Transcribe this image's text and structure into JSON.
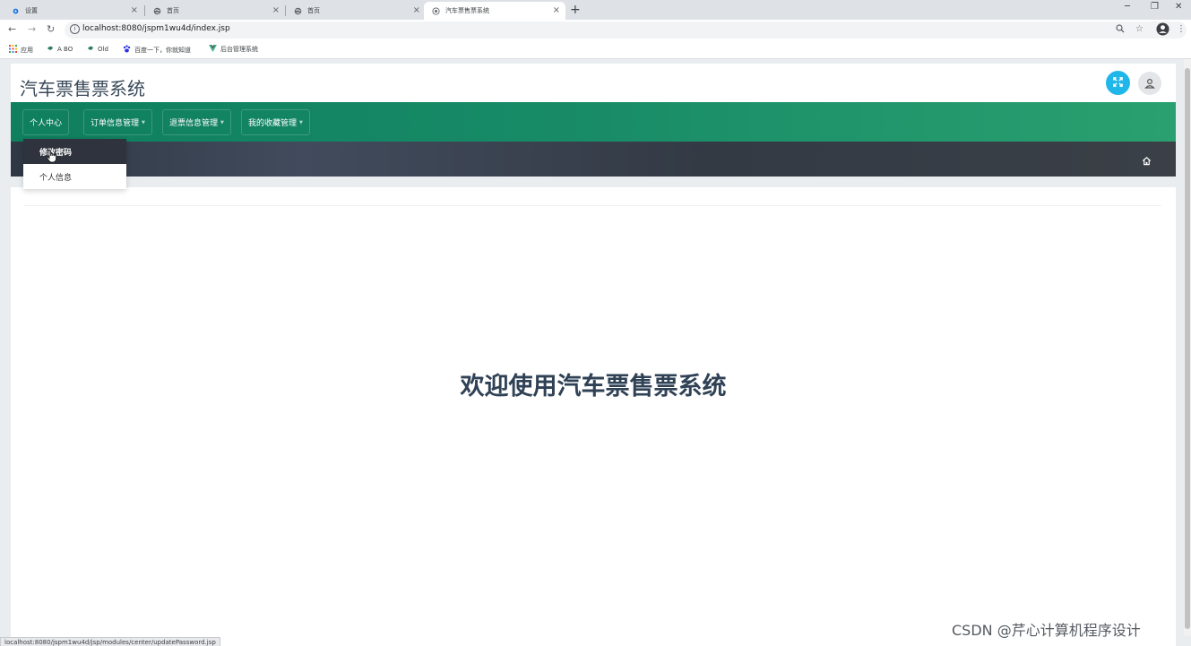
{
  "browser": {
    "tabs": [
      {
        "title": "设置",
        "icon": "gear-icon",
        "active": false
      },
      {
        "title": "首页",
        "icon": "globe-icon",
        "active": false
      },
      {
        "title": "首页",
        "icon": "globe-icon",
        "active": false
      },
      {
        "title": "汽车票售票系统",
        "icon": "site-icon",
        "active": true
      }
    ],
    "new_tab": "+",
    "url": "localhost:8080/jspm1wu4d/index.jsp",
    "bookmarks": [
      {
        "label": "应用",
        "icon": "apps-grid-icon"
      },
      {
        "label": "A BO",
        "icon": "bookmark-dot-icon"
      },
      {
        "label": "Old",
        "icon": "bookmark-dot-icon"
      },
      {
        "label": "百度一下，你就知道",
        "icon": "baidu-paw-icon"
      },
      {
        "label": "后台管理系统",
        "icon": "vue-logo-icon"
      }
    ],
    "status_url": "localhost:8080/jspm1wu4d/jsp/modules/center/updatePassword.jsp"
  },
  "app": {
    "title": "汽车票售票系统",
    "nav": [
      {
        "label": "个人中心"
      },
      {
        "label": "订单信息管理"
      },
      {
        "label": "退票信息管理"
      },
      {
        "label": "我的收藏管理"
      }
    ],
    "dropdown": [
      {
        "label": "修改密码"
      },
      {
        "label": "个人信息"
      }
    ],
    "welcome": "欢迎使用汽车票售票系统"
  },
  "watermark": "CSDN @芹心计算机程序设计",
  "colors": {
    "nav_green": "#178a66",
    "expand_button": "#1fb6ea",
    "welcome_text": "#2f4155",
    "breadcrumb_dark": "#333a44"
  }
}
